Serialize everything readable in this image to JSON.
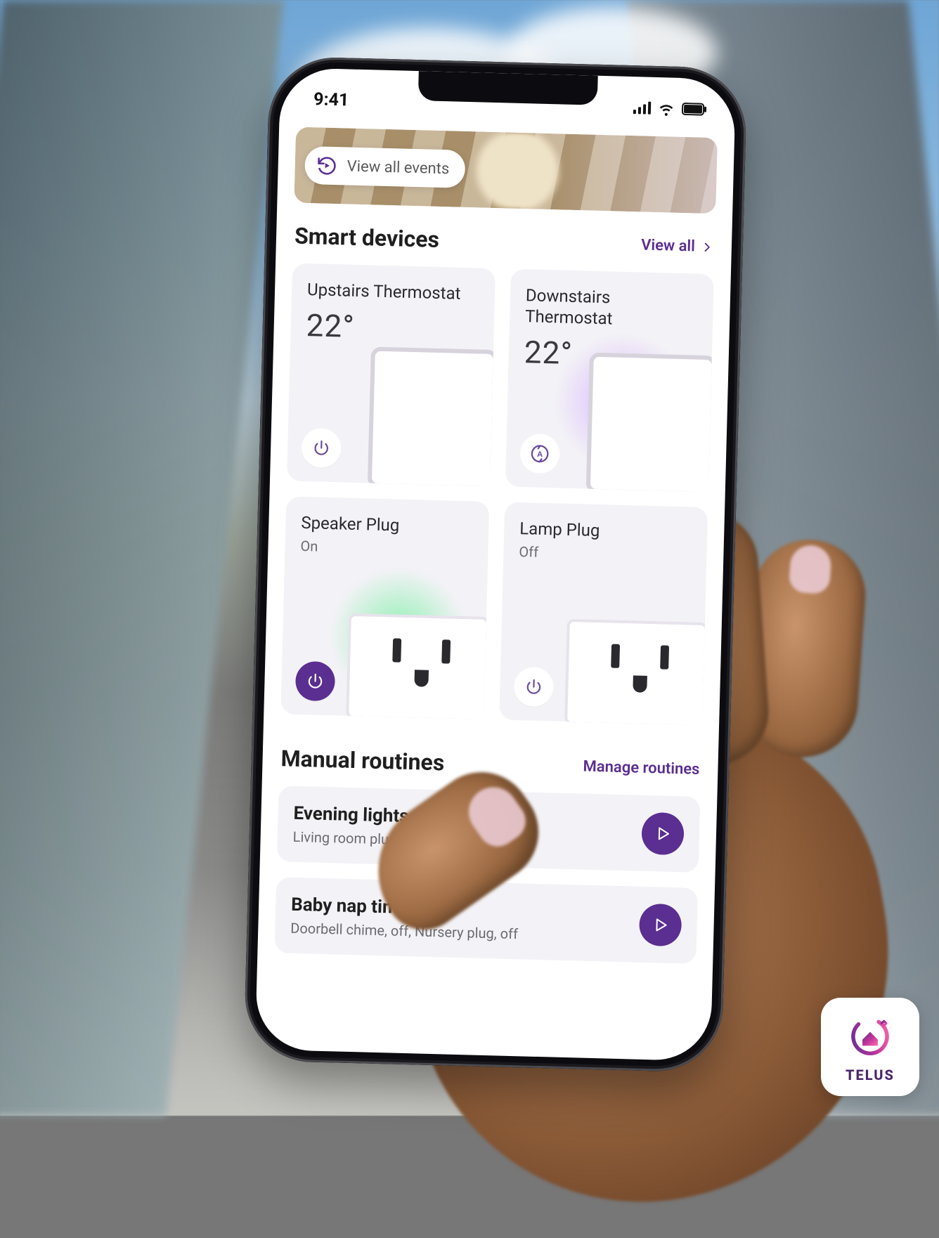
{
  "status_bar": {
    "time": "9:41"
  },
  "events": {
    "view_all_label": "View all events"
  },
  "smart_devices": {
    "title": "Smart devices",
    "view_all_label": "View all",
    "cards": [
      {
        "name": "Upstairs Thermostat",
        "value": "22°"
      },
      {
        "name": "Downstairs Thermostat",
        "value": "22°"
      },
      {
        "name": "Speaker Plug",
        "status": "On"
      },
      {
        "name": "Lamp Plug",
        "status": "Off"
      }
    ]
  },
  "routines": {
    "title": "Manual routines",
    "manage_label": "Manage routines",
    "items": [
      {
        "name": "Evening lights",
        "desc": "Living room plug"
      },
      {
        "name": "Baby nap time",
        "desc": "Doorbell chime, off, Nursery plug, off"
      }
    ]
  },
  "brand": {
    "name": "TELUS"
  }
}
